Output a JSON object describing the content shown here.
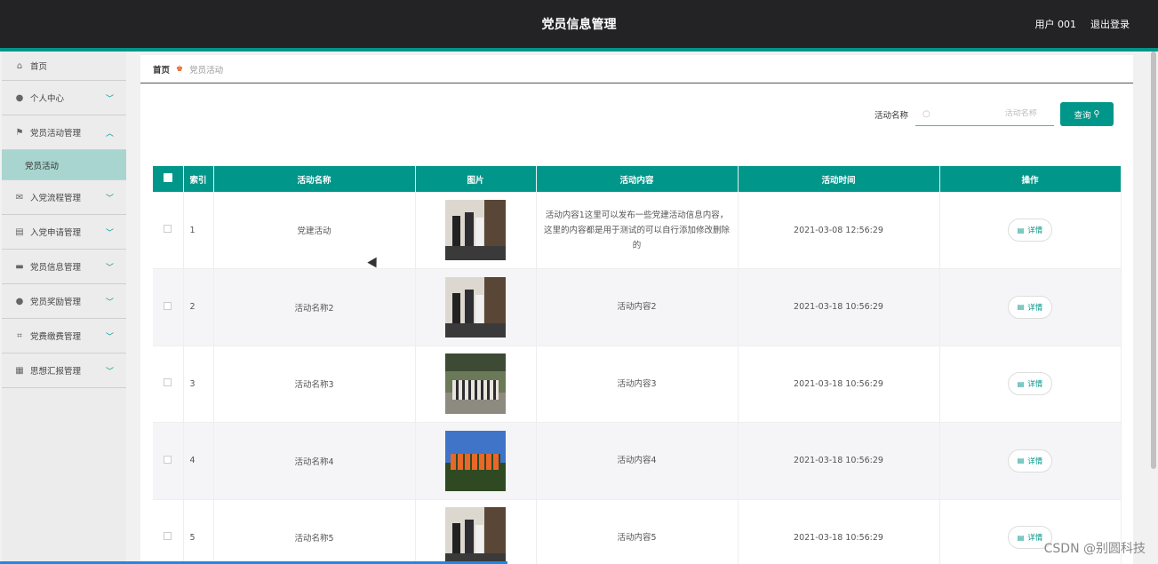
{
  "header": {
    "title": "党员信息管理",
    "user_label": "用户 001",
    "logout_label": "退出登录"
  },
  "sidebar": {
    "items": [
      {
        "label": "首页",
        "icon": "home-icon"
      },
      {
        "label": "个人中心",
        "icon": "user-icon"
      },
      {
        "label": "党员活动管理",
        "icon": "flag-icon",
        "expanded": true
      },
      {
        "label": "入党流程管理",
        "icon": "mail-icon"
      },
      {
        "label": "入党申请管理",
        "icon": "clipboard-icon"
      },
      {
        "label": "党员信息管理",
        "icon": "card-icon"
      },
      {
        "label": "党员奖励管理",
        "icon": "user-icon"
      },
      {
        "label": "党费缴费管理",
        "icon": "crop-icon"
      },
      {
        "label": "思想汇报管理",
        "icon": "document-icon"
      }
    ],
    "sub_item": "党员活动"
  },
  "breadcrumb": {
    "home": "首页",
    "current": "党员活动"
  },
  "search": {
    "label": "活动名称",
    "placeholder": "活动名称",
    "button_label": "查询"
  },
  "table": {
    "headers": [
      "索引",
      "活动名称",
      "图片",
      "活动内容",
      "活动时间",
      "操作"
    ],
    "rows": [
      {
        "index": "1",
        "name": "党建活动",
        "content": "活动内容1这里可以发布一些党建活动信息内容，这里的内容都是用于测试的可以自行添加修改删除的",
        "time": "2021-03-08 12:56:29",
        "image": "indoor-group-photo",
        "action": "详情"
      },
      {
        "index": "2",
        "name": "活动名称2",
        "content": "活动内容2",
        "time": "2021-03-18 10:56:29",
        "image": "indoor-group-photo",
        "action": "详情"
      },
      {
        "index": "3",
        "name": "活动名称3",
        "content": "活动内容3",
        "time": "2021-03-18 10:56:29",
        "image": "outdoor-group-photo",
        "action": "详情"
      },
      {
        "index": "4",
        "name": "活动名称4",
        "content": "活动内容4",
        "time": "2021-03-18 10:56:29",
        "image": "orange-shirt-group-photo",
        "action": "详情"
      },
      {
        "index": "5",
        "name": "活动名称5",
        "content": "活动内容5",
        "time": "2021-03-18 10:56:29",
        "image": "indoor-group-photo",
        "action": "详情"
      }
    ]
  },
  "watermark": "CSDN @别圆科技",
  "colors": {
    "accent": "#00968a",
    "topbar": "#232325",
    "sidebar_active": "#a8d5cf"
  }
}
